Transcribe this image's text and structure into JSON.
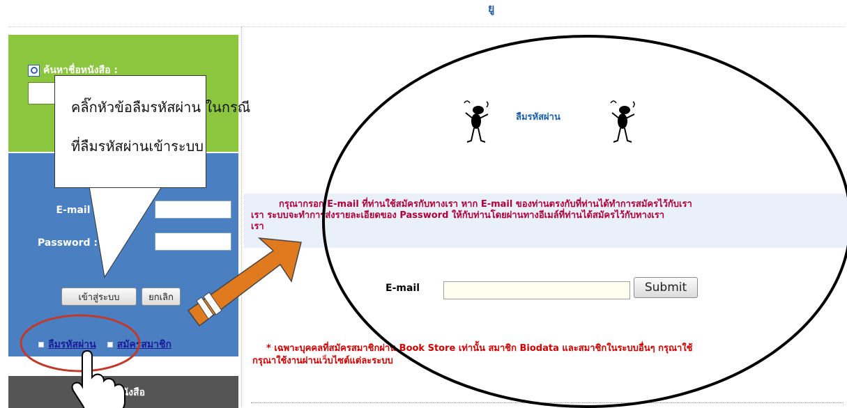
{
  "page": {
    "header_partial": "ยู"
  },
  "sidebar": {
    "search": {
      "label": "ค้นหาชื่อหนังสือ :",
      "icon": "magnifier-icon",
      "input_value": ""
    },
    "login": {
      "email_label": "E-mail :",
      "password_label": "Password :",
      "email_value": "",
      "password_value": "",
      "login_button": "เข้าสู่ระบบ",
      "cancel_button": "ยกเลิก"
    },
    "links": {
      "forgot_password": "ลืมรหัสผ่าน",
      "register": "สมัครสมาชิก"
    },
    "category_header": "หมวดหนังสือ"
  },
  "main": {
    "title": "ลืมรหัสผ่าน",
    "instructions": [
      "กรุณากรอก E-mail ที่ท่านใช้สมัครกับทางเรา หาก E-mail ของท่านตรงกับที่ท่านได้ทำการสมัครไว้กับเรา",
      "เรา ระบบจะทำการส่งรายละเอียดของ Password ให้กับท่านโดยผ่านทางอีเมล์ที่ท่านได้สมัครไว้กับทางเรา",
      "เรา"
    ],
    "email_label": "E-mail",
    "email_value": "",
    "submit_label": "Submit",
    "note": [
      "* เฉพาะบุคคลที่สมัครสมาชิกผ่าน Book Store เท่านั้น สมาชิก Biodata และสมาชิกในระบบอื่นๆ กรุณาใช้",
      "กรุณาใช้งานผ่านเว็บไซต์แต่ละระบบ"
    ]
  },
  "annotation": {
    "callout_lines": [
      "คลิ๊กหัวข้อลืมรหัสผ่าน ในกรณี",
      "ที่ลืมรหัสผ่านเข้าระบบ"
    ],
    "colors": {
      "arrow": "#e07a1e",
      "circle_highlight": "#c0392b",
      "ellipse": "#000000"
    }
  },
  "colors": {
    "search_panel": "#8cc63f",
    "login_panel": "#4a7fc1",
    "category_panel": "#555555",
    "title_blue": "#1a5fb0",
    "instruction_text": "#b0003a",
    "note_text": "#d00000"
  }
}
